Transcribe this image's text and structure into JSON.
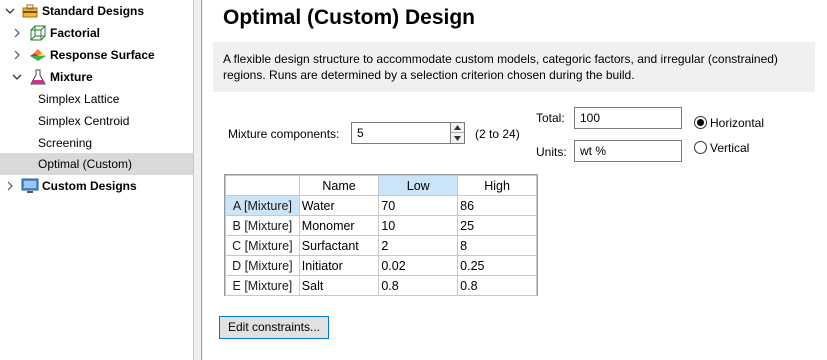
{
  "tree": {
    "items": [
      {
        "label": "Standard Designs",
        "bold": true,
        "expanded": true,
        "icon": "toolbox-icon"
      },
      {
        "label": "Factorial",
        "bold": true,
        "expanded": false,
        "icon": "cube-icon"
      },
      {
        "label": "Response Surface",
        "bold": true,
        "expanded": false,
        "icon": "surface-icon"
      },
      {
        "label": "Mixture",
        "bold": true,
        "expanded": true,
        "icon": "flask-icon"
      },
      {
        "label": "Simplex Lattice",
        "bold": false
      },
      {
        "label": "Simplex Centroid",
        "bold": false
      },
      {
        "label": "Screening",
        "bold": false
      },
      {
        "label": "Optimal (Custom)",
        "bold": false,
        "selected": true
      },
      {
        "label": "Custom Designs",
        "bold": true,
        "expanded": false,
        "icon": "monitor-icon"
      }
    ]
  },
  "main": {
    "title": "Optimal (Custom) Design",
    "description": "A flexible design structure to accommodate custom models, categoric factors, and irregular (constrained) regions. Runs are determined by a selection criterion chosen during the build.",
    "components_label": "Mixture components:",
    "components_value": "5",
    "components_range": "(2 to 24)",
    "total_label": "Total:",
    "total_value": "100",
    "units_label": "Units:",
    "units_value": "wt %",
    "orientation": {
      "horizontal_label": "Horizontal",
      "vertical_label": "Vertical",
      "selected": "Horizontal"
    },
    "grid": {
      "columns": [
        "Name",
        "Low",
        "High"
      ],
      "rows": [
        {
          "id": "A [Mixture]",
          "name": "Water",
          "low": "70",
          "high": "86"
        },
        {
          "id": "B [Mixture]",
          "name": "Monomer",
          "low": "10",
          "high": "25"
        },
        {
          "id": "C [Mixture]",
          "name": "Surfactant",
          "low": "2",
          "high": "8"
        },
        {
          "id": "D [Mixture]",
          "name": "Initiator",
          "low": "0.02",
          "high": "0.25"
        },
        {
          "id": "E [Mixture]",
          "name": "Salt",
          "low": "0.8",
          "high": "0.8"
        }
      ]
    },
    "edit_button": "Edit constraints..."
  },
  "colors": {
    "selected_row": "#d9d9d9",
    "header_highlight": "#cce4f7",
    "button_border": "#0078d7"
  }
}
